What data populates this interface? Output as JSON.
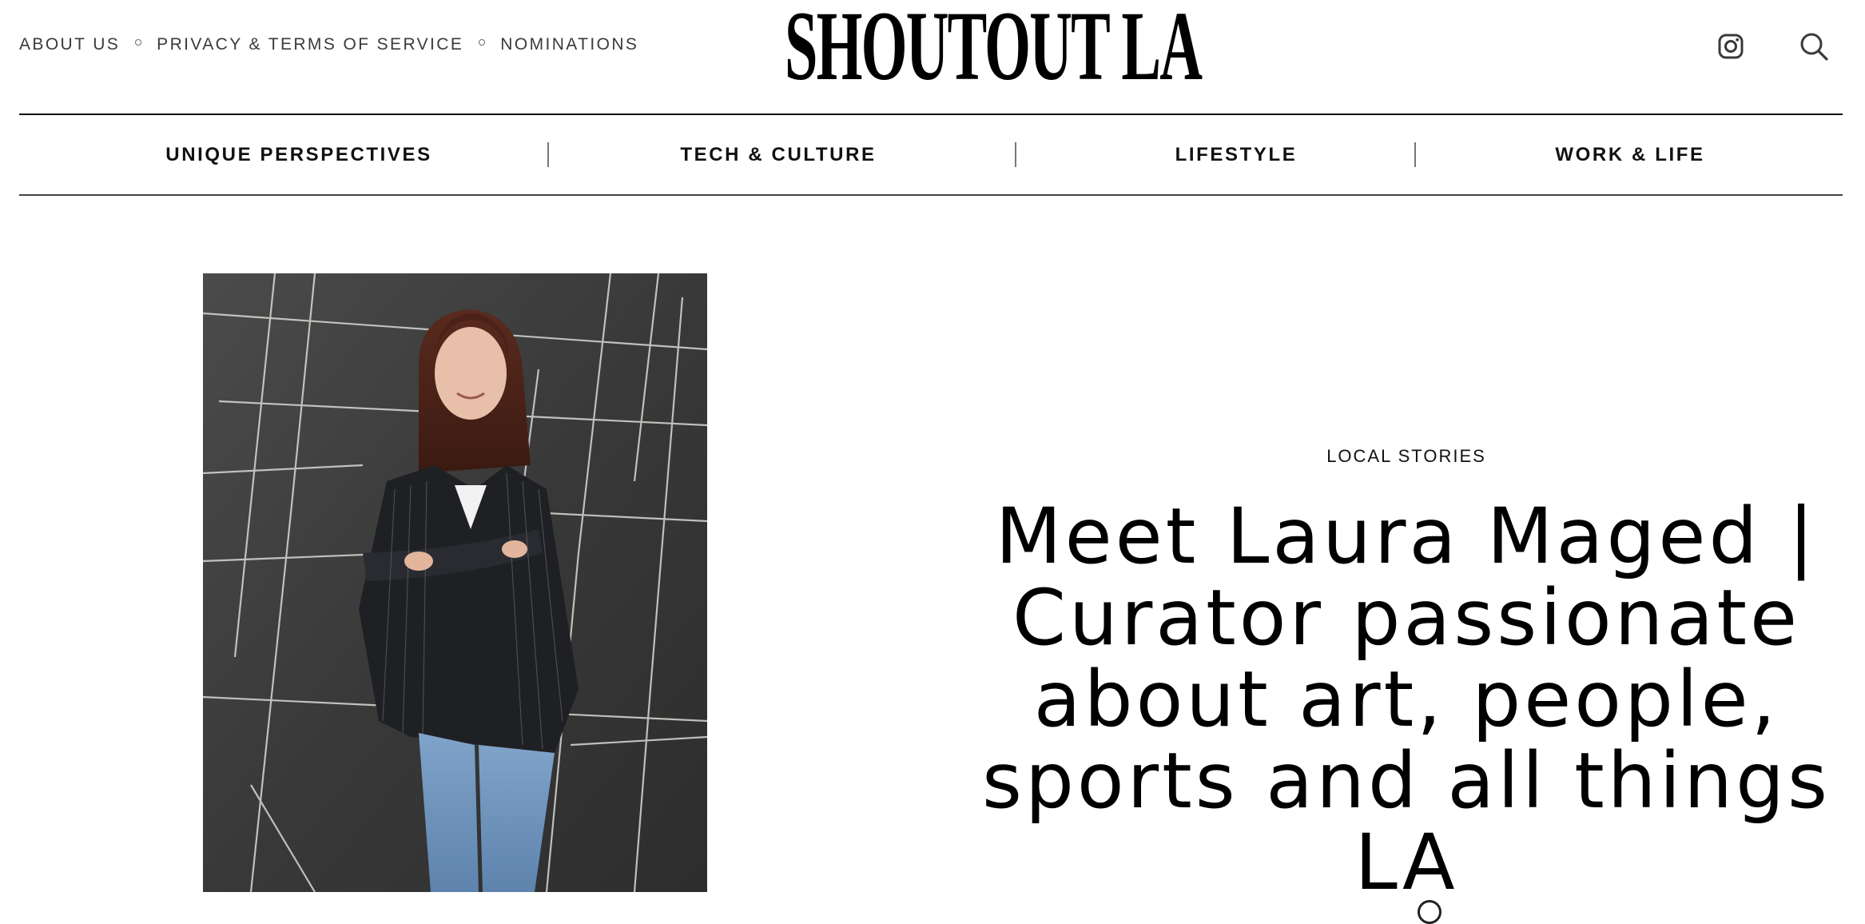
{
  "header": {
    "top_links": [
      {
        "label": "ABOUT US"
      },
      {
        "label": "PRIVACY & TERMS OF SERVICE"
      },
      {
        "label": "NOMINATIONS"
      }
    ],
    "logo_text": "SHOUTOUT LA",
    "icons": [
      "instagram-icon",
      "search-icon"
    ]
  },
  "nav": {
    "items": [
      {
        "label": "UNIQUE PERSPECTIVES"
      },
      {
        "label": "TECH & CULTURE"
      },
      {
        "label": "LIFESTYLE"
      },
      {
        "label": "WORK & LIFE"
      }
    ]
  },
  "article": {
    "category": "LOCAL STORIES",
    "title": "Meet Laura Maged | Curator passionate about art, people, sports and all things LA",
    "photo_alt": "Woman with long auburn hair in pinstripe blazer and jeans, arms crossed, leaning against black marble wall"
  },
  "colors": {
    "text": "#000000",
    "muted_text": "#3a3a3a",
    "rule": "#111111",
    "photo_wall": "#3e3f3e"
  }
}
